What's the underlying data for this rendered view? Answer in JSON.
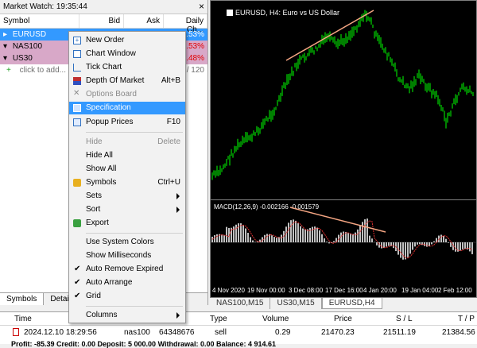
{
  "market_watch": {
    "title": "Market Watch: 19:35:44",
    "columns": {
      "symbol": "Symbol",
      "bid": "Bid",
      "ask": "Ask",
      "change": "Daily Ch..."
    },
    "rows": [
      {
        "symbol": "EURUSD",
        "bid": "",
        "ask": "",
        "change": "0.53%"
      },
      {
        "symbol": "NAS100",
        "bid": "",
        "ask": "",
        "change": "1.53%"
      },
      {
        "symbol": "US30",
        "bid": "",
        "ask": "",
        "change": "1.48%"
      }
    ],
    "add_label": "click to add...",
    "count": "/ 120",
    "tabs": [
      "Symbols",
      "Detai"
    ]
  },
  "context_menu": {
    "new_order": "New Order",
    "chart_window": "Chart Window",
    "tick_chart": "Tick Chart",
    "depth_of_market": "Depth Of Market",
    "depth_shortcut": "Alt+B",
    "options_board": "Options Board",
    "specification": "Specification",
    "popup_prices": "Popup Prices",
    "popup_shortcut": "F10",
    "hide": "Hide",
    "hide_shortcut": "Delete",
    "hide_all": "Hide All",
    "show_all": "Show All",
    "symbols": "Symbols",
    "symbols_shortcut": "Ctrl+U",
    "sets": "Sets",
    "sort": "Sort",
    "export": "Export",
    "use_system_colors": "Use System Colors",
    "show_milliseconds": "Show Milliseconds",
    "auto_remove_expired": "Auto Remove Expired",
    "auto_arrange": "Auto Arrange",
    "grid": "Grid",
    "columns": "Columns"
  },
  "chart": {
    "title": "EURUSD, H4:  Euro vs US Dollar",
    "macd_label": "MACD(12,26,9) -0.002166 -0.001579",
    "time_labels": [
      "4 Nov 2020",
      "19 Nov 00:00",
      "3 Dec 08:00",
      "17 Dec 16:00",
      "4 Jan 20:00",
      "19 Jan 04:00",
      "2 Feb 12:00"
    ],
    "tabs": [
      "NAS100,M15",
      "US30,M15",
      "EURUSD,H4"
    ],
    "colors": {
      "bars": "#00ff00",
      "trend": "#f4a582",
      "hist": "#c0c0c0",
      "signal": "#e03030"
    }
  },
  "terminal": {
    "headers": {
      "time": "Time",
      "type": "Type",
      "volume": "Volume",
      "price": "Price",
      "sl": "S / L",
      "tp": "T / P"
    },
    "row": {
      "time": "2024.12.10 18:29:56",
      "symbol": "nas100",
      "ticket": "64348676",
      "type": "sell",
      "volume": "0.29",
      "price": "21470.23",
      "sl": "21511.19",
      "tp": "21384.56"
    },
    "balance": "Profit: -85.39  Credit: 0.00  Deposit: 5 000.00  Withdrawal: 0.00  Balance: 4 914.61"
  }
}
